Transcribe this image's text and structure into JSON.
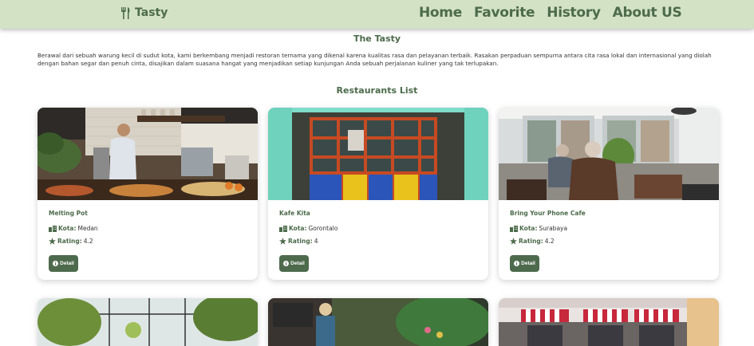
{
  "navbar": {
    "brand": "Tasty",
    "links": [
      "Home",
      "Favorite",
      "History",
      "About US"
    ]
  },
  "intro": {
    "title": "The Tasty",
    "description": "Berawal dari sebuah warung kecil di sudut kota, kami berkembang menjadi restoran ternama yang dikenal karena kualitas rasa dan pelayanan terbaik. Rasakan perpaduan sempurna antara cita rasa lokal dan internasional yang diolah dengan bahan segar dan penuh cinta, disajikan dalam suasana hangat yang menjadikan setiap kunjungan Anda sebuah perjalanan kuliner yang tak terlupakan."
  },
  "restaurants": {
    "heading": "Restaurants List",
    "city_label": "Kota:",
    "rating_label": "Rating:",
    "detail_label": "Detail",
    "items": [
      {
        "name": "Melting Pot",
        "city": "Medan",
        "rating": "4.2"
      },
      {
        "name": "Kafe Kita",
        "city": "Gorontalo",
        "rating": "4"
      },
      {
        "name": "Bring Your Phone Cafe",
        "city": "Surabaya",
        "rating": "4.2"
      }
    ]
  },
  "colors": {
    "primary": "#4c6b4b",
    "navbar_bg": "#d3e2c4",
    "button_bg": "#4e6a4d"
  },
  "icons": {
    "brand": "utensils-icon",
    "city": "city-icon",
    "rating": "star-icon",
    "detail": "info-circle-icon"
  }
}
